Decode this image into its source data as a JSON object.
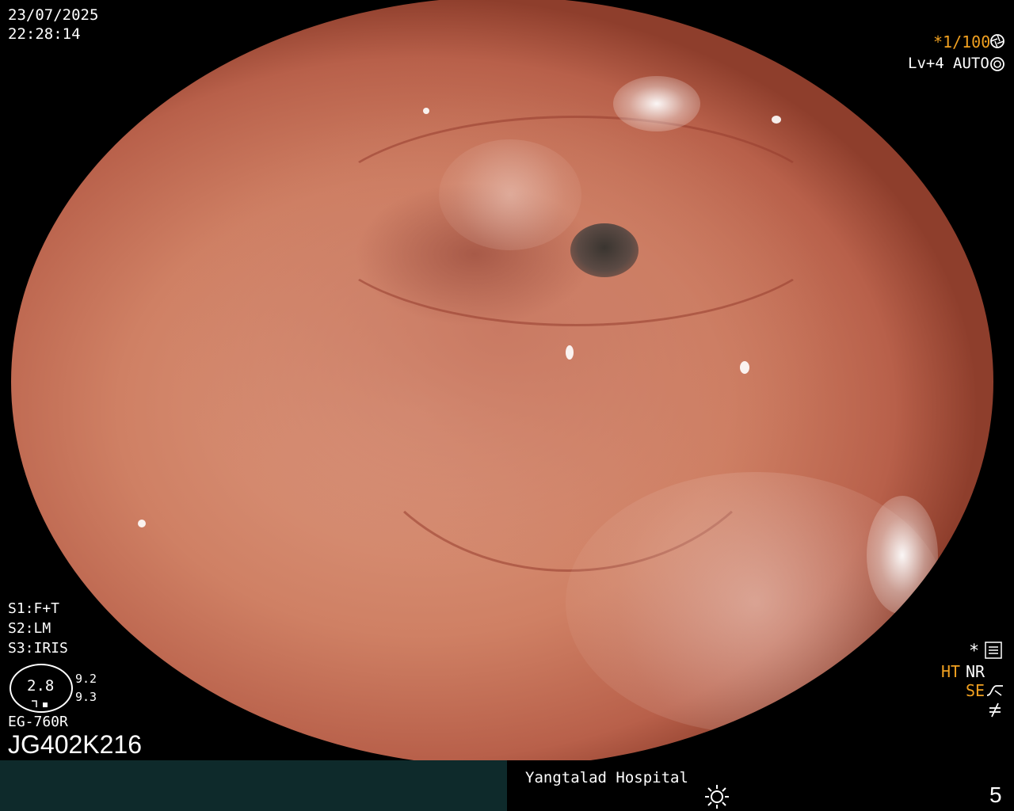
{
  "overlay": {
    "date": "23/07/2025",
    "time": "22:28:14",
    "shutter": "*1/100",
    "shutter_icon": "aperture-icon",
    "light_level": "Lv+4",
    "exposure_mode": "AUTO",
    "exposure_icon": "iris-icon",
    "s1": "S1:F+T",
    "s2": "S2:LM",
    "s3": "S3:IRIS",
    "gauge_value": "2.8",
    "gauge_right_top": "9.2",
    "gauge_right_bottom": "9.3",
    "scope_model": "EG-760R",
    "scope_serial": "JG402K216",
    "asterisk": "*",
    "ht": "HT",
    "nr": "NR",
    "se": "SE",
    "side_icons": [
      "settings-list-icon",
      "se-curve-icon",
      "not-equal-icon"
    ]
  },
  "footer": {
    "hospital": "Yangtalad Hospital",
    "brightness_icon": "sun-icon",
    "image_number": "5"
  },
  "colors": {
    "accent_orange": "#f0a020",
    "text_white": "#ffffff",
    "footer_bg": "#0e2a2b"
  }
}
